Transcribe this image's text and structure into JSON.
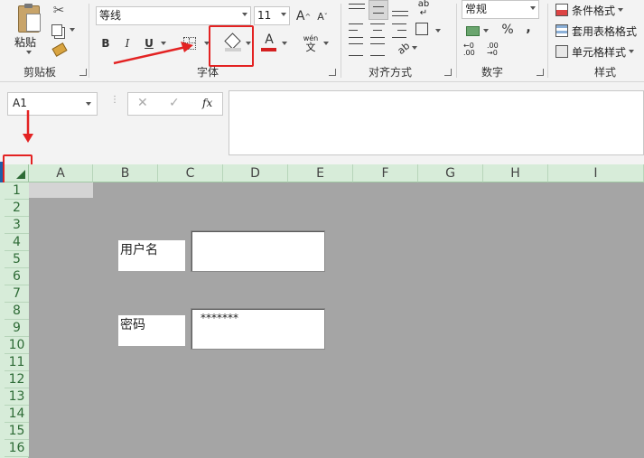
{
  "ribbon": {
    "clipboard": {
      "paste_label": "粘贴",
      "group_label": "剪贴板"
    },
    "font": {
      "font_name": "等线",
      "font_size": "11",
      "bold": "B",
      "italic": "I",
      "underline": "U",
      "grow_label": "A",
      "shrink_label": "A",
      "font_color_label": "A",
      "phonetic_label": "wén",
      "phonetic_sub": "文",
      "group_label": "字体"
    },
    "alignment": {
      "group_label": "对齐方式",
      "orientation_label": "ab"
    },
    "number": {
      "format": "常规",
      "percent": "%",
      "comma": ",",
      "increase_decimal": ".00",
      "decrease_decimal": ".00",
      "group_label": "数字"
    },
    "styles": {
      "conditional": "条件格式",
      "table_format": "套用表格格式",
      "cell_styles": "单元格样式",
      "group_label": "样式"
    }
  },
  "formula_bar": {
    "name_box": "A1",
    "fx": "fx",
    "cancel": "✕",
    "enter": "✓",
    "formula": ""
  },
  "columns": [
    "A",
    "B",
    "C",
    "D",
    "E",
    "F",
    "G",
    "H",
    "I"
  ],
  "rows": [
    "1",
    "2",
    "3",
    "4",
    "5",
    "6",
    "7",
    "8",
    "9",
    "10",
    "11",
    "12",
    "13",
    "14",
    "15",
    "16"
  ],
  "form": {
    "username_label": "用户名",
    "username_value": "",
    "password_label": "密码",
    "password_value": "*******"
  },
  "colors": {
    "highlight": "#e32222",
    "header_green": "#d7ecd9",
    "sheet_gray": "#a5a5a5"
  }
}
